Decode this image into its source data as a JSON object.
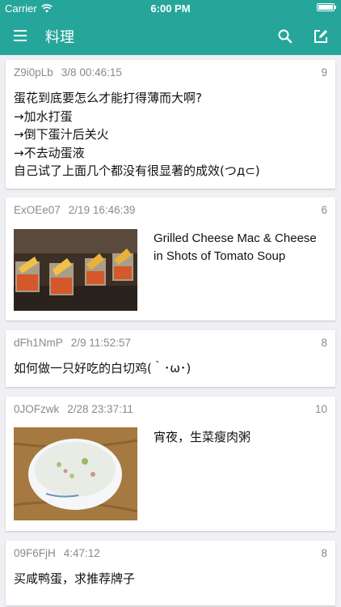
{
  "status_bar": {
    "carrier": "Carrier",
    "time": "6:00 PM"
  },
  "header": {
    "title": "料理"
  },
  "colors": {
    "primary": "#26a69a",
    "background": "#efeff4",
    "meta_text": "#8a8a8a"
  },
  "icons": {
    "menu": "menu-icon",
    "search": "search-icon",
    "compose": "compose-icon"
  },
  "posts": [
    {
      "user_id": "Z9i0pLb",
      "date": "3/8 00:46:15",
      "count": "9",
      "lines": [
        "蛋花到底要怎么才能打得薄而大啊?",
        "→加水打蛋",
        "→倒下蛋汁后关火",
        "→不去动蛋液",
        "自己试了上面几个都没有很显著的成效(つд⊂)"
      ]
    },
    {
      "user_id": "ExOEe07",
      "date": "2/19 16:46:39",
      "count": "6",
      "text": "Grilled Cheese Mac & Cheese in Shots of Tomato Soup",
      "image": "grilled-cheese-tomato-soup-shots"
    },
    {
      "user_id": "dFh1NmP",
      "date": "2/9 11:52:57",
      "count": "8",
      "text": "如何做一只好吃的白切鸡(｀･ω･)"
    },
    {
      "user_id": "0JOFzwk",
      "date": "2/28 23:37:11",
      "count": "10",
      "text": "宵夜，生菜瘦肉粥",
      "image": "congee-bowl"
    },
    {
      "user_id": "09F6FjH",
      "date": "4:47:12",
      "count": "8",
      "text": "买咸鸭蛋，求推荐牌子"
    }
  ]
}
